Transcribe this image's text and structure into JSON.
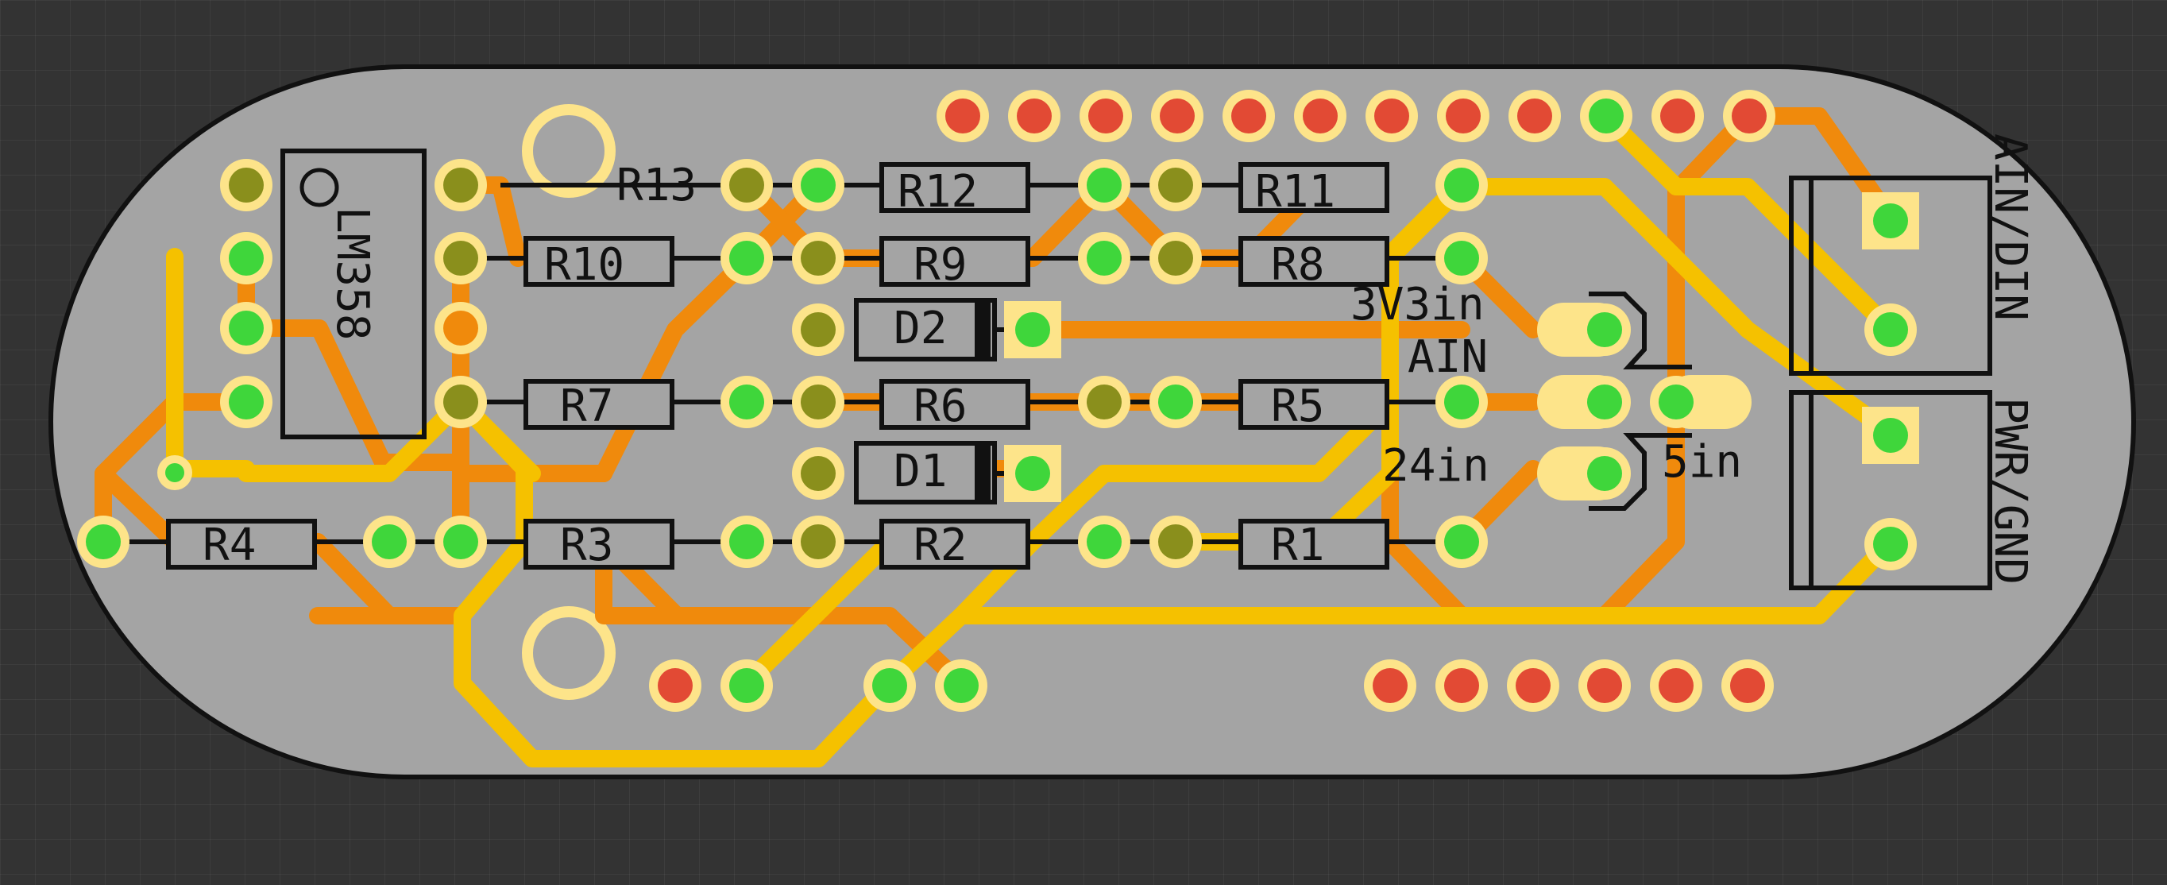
{
  "colors": {
    "background": "#333333",
    "board": "#a4a4a4",
    "outline": "#111111",
    "trace_orange": "#f08a0c",
    "trace_yellow": "#f5c100",
    "pad_ring": "#fde48a",
    "pad_green": "#3fd63b",
    "pad_red": "#e24a34",
    "pad_olive": "#8a8f1c"
  },
  "ic": {
    "label": "LM358"
  },
  "resistors": [
    "R13",
    "R12",
    "R11",
    "R10",
    "R9",
    "R8",
    "R7",
    "R6",
    "R5",
    "R4",
    "R3",
    "R2",
    "R1"
  ],
  "diodes": [
    "D2",
    "D1"
  ],
  "jumper_labels": {
    "v33": "3V3in",
    "ain": "AIN",
    "v24": "24in",
    "v5": "5in"
  },
  "connector_labels": [
    "AIN/DIN",
    "PWR/GND"
  ]
}
